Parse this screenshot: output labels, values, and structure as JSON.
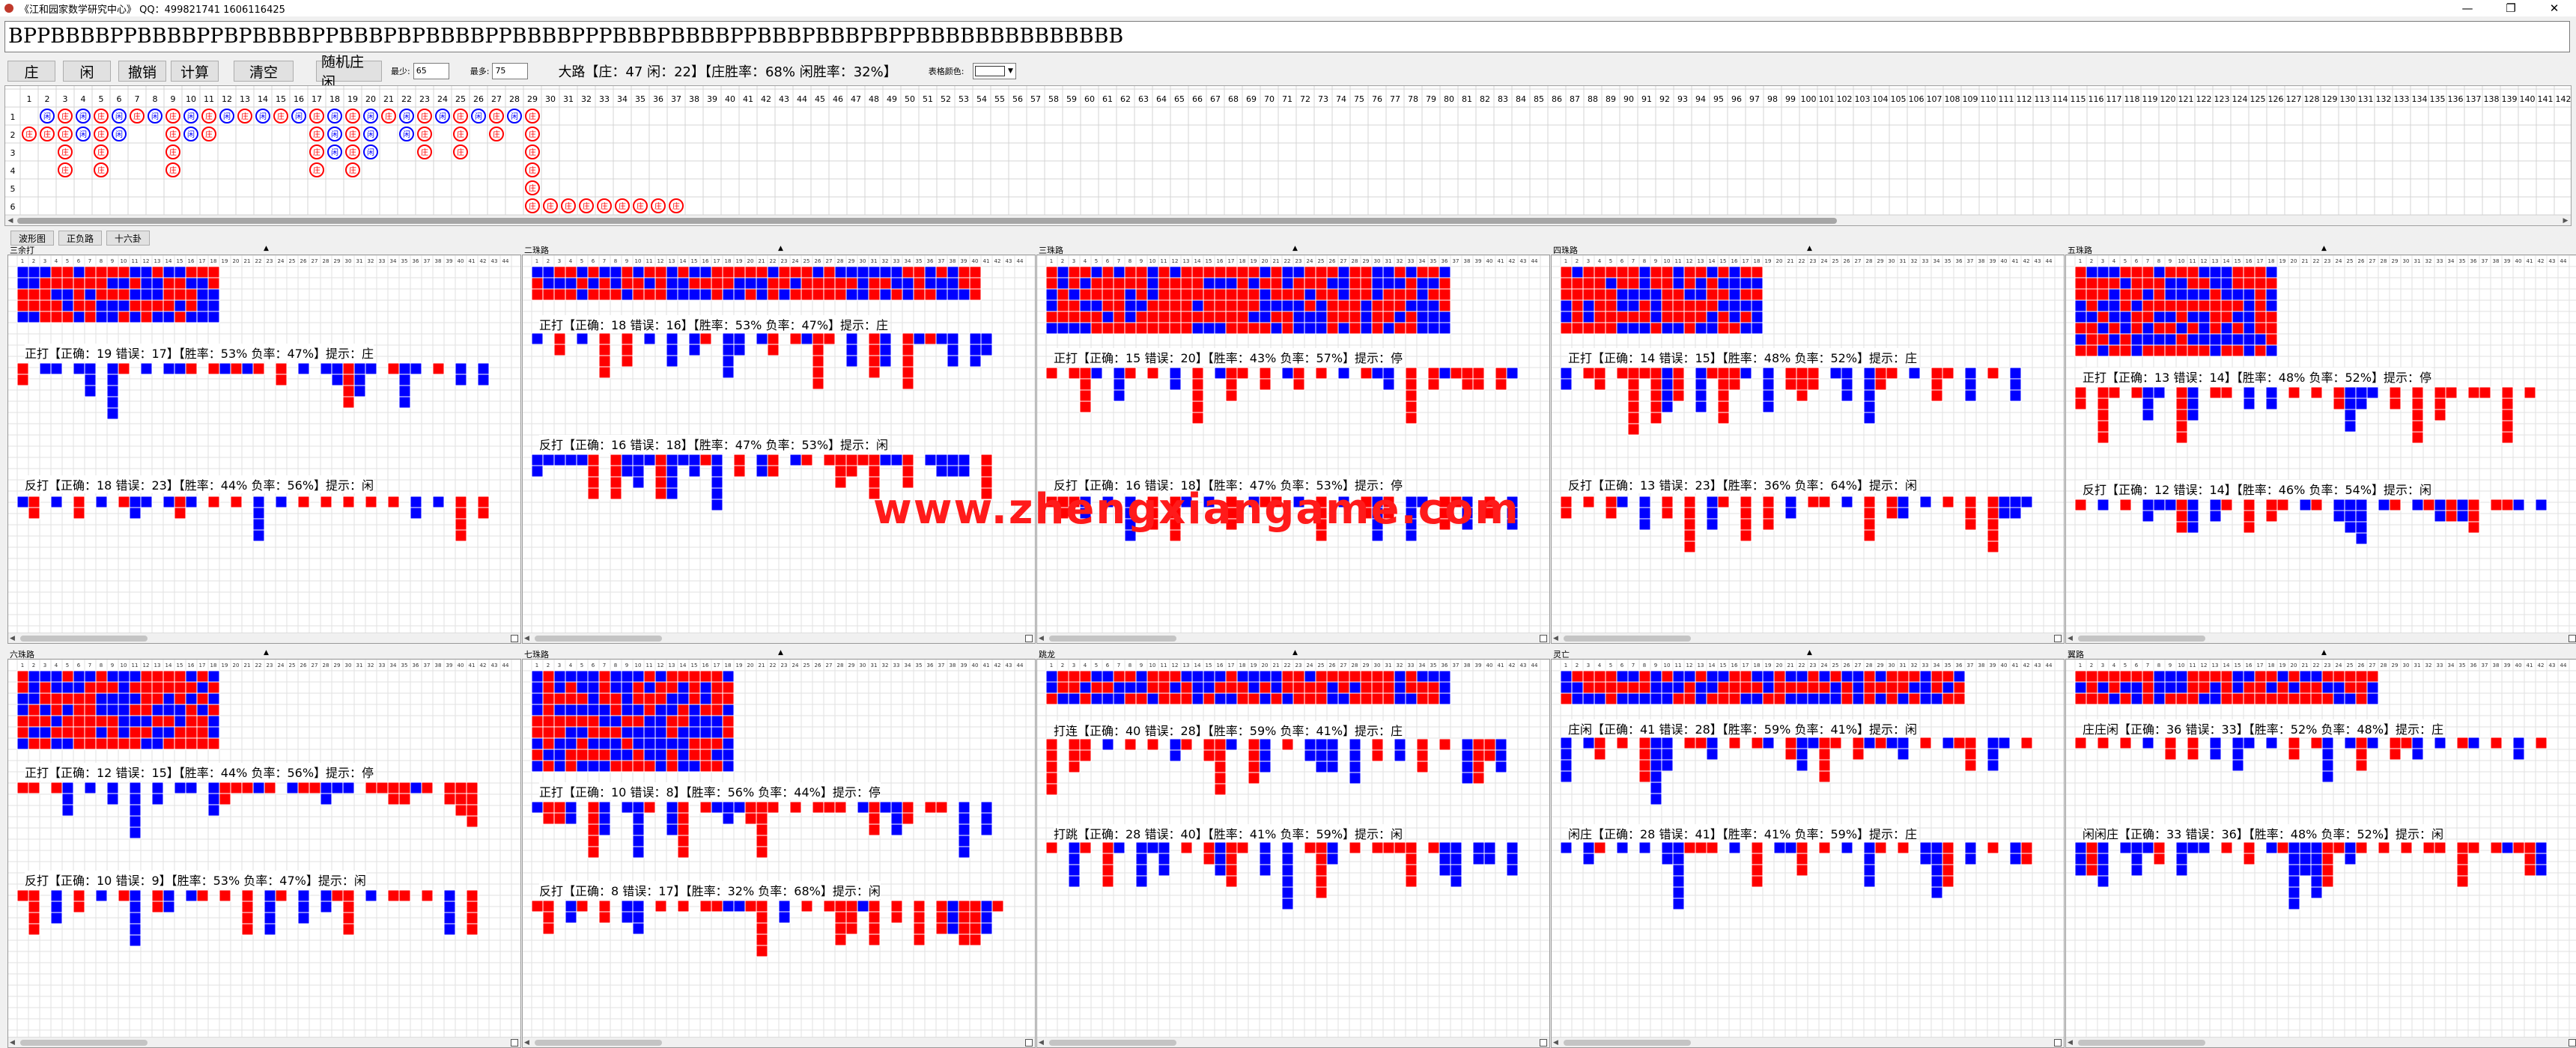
{
  "window": {
    "title": "《江和园家数学研究中心》 QQ：499821741 1606116425",
    "controls": [
      "—",
      "❐",
      "✕"
    ]
  },
  "sequence": "BPPBBBBPPBBBBPPBPBBBBPPBBBPBPBBBBPPBBBBPPPBBBPBBBBPPBBBPBBBPBPPBBBBBBBBBBBBBB",
  "toolbar": {
    "buttons": [
      "庄",
      "闲",
      "撤销",
      "计算",
      "清空",
      "随机庄闲"
    ],
    "min_label": "最少:",
    "min_value": "65",
    "max_label": "最多:",
    "max_value": "75",
    "stats_text": "大路【庄：47 闲：22】【庄胜率：68% 闲胜率：32%】",
    "color_label": "表格颜色:"
  },
  "big_road": {
    "column_count": 142,
    "row_labels": [
      "1",
      "2",
      "3",
      "4",
      "5",
      "6"
    ],
    "banker_char": "庄",
    "player_char": "闲",
    "cells": [
      [
        1,
        2,
        "B"
      ],
      [
        2,
        1,
        "P"
      ],
      [
        2,
        2,
        "B"
      ],
      [
        3,
        1,
        "B"
      ],
      [
        3,
        2,
        "B"
      ],
      [
        3,
        3,
        "B"
      ],
      [
        3,
        4,
        "B"
      ],
      [
        4,
        1,
        "P"
      ],
      [
        4,
        2,
        "P"
      ],
      [
        5,
        1,
        "B"
      ],
      [
        5,
        2,
        "B"
      ],
      [
        5,
        3,
        "B"
      ],
      [
        5,
        4,
        "B"
      ],
      [
        6,
        1,
        "P"
      ],
      [
        6,
        2,
        "P"
      ],
      [
        7,
        1,
        "B"
      ],
      [
        8,
        1,
        "P"
      ],
      [
        9,
        1,
        "B"
      ],
      [
        9,
        2,
        "B"
      ],
      [
        9,
        3,
        "B"
      ],
      [
        9,
        4,
        "B"
      ],
      [
        10,
        1,
        "P"
      ],
      [
        10,
        2,
        "P"
      ],
      [
        11,
        1,
        "B"
      ],
      [
        11,
        2,
        "B"
      ],
      [
        12,
        1,
        "P"
      ],
      [
        13,
        1,
        "B"
      ],
      [
        14,
        1,
        "P"
      ],
      [
        15,
        1,
        "B"
      ],
      [
        16,
        1,
        "P"
      ],
      [
        17,
        1,
        "B"
      ],
      [
        17,
        2,
        "B"
      ],
      [
        17,
        3,
        "B"
      ],
      [
        17,
        4,
        "B"
      ],
      [
        18,
        1,
        "P"
      ],
      [
        18,
        2,
        "P"
      ],
      [
        18,
        3,
        "P"
      ],
      [
        19,
        1,
        "B"
      ],
      [
        19,
        2,
        "B"
      ],
      [
        19,
        3,
        "B"
      ],
      [
        19,
        4,
        "B"
      ],
      [
        20,
        1,
        "P"
      ],
      [
        20,
        2,
        "P"
      ],
      [
        20,
        3,
        "P"
      ],
      [
        21,
        1,
        "B"
      ],
      [
        22,
        1,
        "P"
      ],
      [
        22,
        2,
        "P"
      ],
      [
        23,
        1,
        "B"
      ],
      [
        23,
        2,
        "B"
      ],
      [
        23,
        3,
        "B"
      ],
      [
        24,
        1,
        "P"
      ],
      [
        25,
        1,
        "B"
      ],
      [
        25,
        2,
        "B"
      ],
      [
        25,
        3,
        "B"
      ],
      [
        26,
        1,
        "P"
      ],
      [
        27,
        1,
        "B"
      ],
      [
        27,
        2,
        "B"
      ],
      [
        28,
        1,
        "P"
      ],
      [
        29,
        1,
        "B"
      ],
      [
        29,
        2,
        "B"
      ],
      [
        29,
        3,
        "B"
      ],
      [
        29,
        4,
        "B"
      ],
      [
        29,
        5,
        "B"
      ],
      [
        29,
        6,
        "B"
      ],
      [
        30,
        6,
        "B"
      ],
      [
        31,
        6,
        "B"
      ],
      [
        32,
        6,
        "B"
      ],
      [
        33,
        6,
        "B"
      ],
      [
        34,
        6,
        "B"
      ],
      [
        35,
        6,
        "B"
      ],
      [
        36,
        6,
        "B"
      ],
      [
        37,
        6,
        "B"
      ]
    ]
  },
  "tabs": [
    "波形图",
    "正负路",
    "十六卦"
  ],
  "colors": {
    "banker": "#ff0000",
    "player": "#0000ff",
    "grid": "#d4d4d4",
    "watermark": "#ff1a1a"
  },
  "panels": [
    {
      "title": "三余打",
      "rows": [
        {
          "label": "正打【正确：19 错误：17】【胜率：53% 负率：47%】提示：庄"
        },
        {
          "label": "反打【正确：18 错误：23】【胜率：44% 负率：56%】提示：闲"
        }
      ]
    },
    {
      "title": "二珠路",
      "rows": [
        {
          "label": "正打【正确：18 错误：16】【胜率：53% 负率：47%】提示：庄"
        },
        {
          "label": "反打【正确：16 错误：18】【胜率：47% 负率：53%】提示：闲"
        }
      ]
    },
    {
      "title": "三珠路",
      "rows": [
        {
          "label": "正打【正确：15 错误：20】【胜率：43% 负率：57%】提示：停"
        },
        {
          "label": "反打【正确：16 错误：18】【胜率：47% 负率：53%】提示：停"
        }
      ]
    },
    {
      "title": "四珠路",
      "rows": [
        {
          "label": "正打【正确：14 错误：15】【胜率：48% 负率：52%】提示：庄"
        },
        {
          "label": "反打【正确：13 错误：23】【胜率：36% 负率：64%】提示：闲"
        }
      ]
    },
    {
      "title": "五珠路",
      "rows": [
        {
          "label": "正打【正确：13 错误：14】【胜率：48% 负率：52%】提示：停"
        },
        {
          "label": "反打【正确：12 错误：14】【胜率：46% 负率：54%】提示：闲"
        }
      ]
    },
    {
      "title": "六珠路",
      "rows": [
        {
          "label": "正打【正确：12 错误：15】【胜率：44% 负率：56%】提示：停"
        },
        {
          "label": "反打【正确：10 错误：9】【胜率：53% 负率：47%】提示：闲"
        }
      ]
    },
    {
      "title": "七珠路",
      "rows": [
        {
          "label": "正打【正确：10 错误：8】【胜率：56% 负率：44%】提示：停"
        },
        {
          "label": "反打【正确：8 错误：17】【胜率：32% 负率：68%】提示：闲"
        }
      ]
    },
    {
      "title": "跳龙",
      "rows": [
        {
          "label": "打连【正确：40 错误：28】【胜率：59% 负率：41%】提示：庄"
        },
        {
          "label": "打跳【正确：28 错误：40】【胜率：41% 负率：59%】提示：闲"
        }
      ]
    },
    {
      "title": "灵亡",
      "rows": [
        {
          "label": "庄闲【正确：41 错误：28】【胜率：59% 负率：41%】提示：闲"
        },
        {
          "label": "闲庄【正确：28 错误：41】【胜率：41% 负率：59%】提示：庄"
        }
      ]
    },
    {
      "title": "翼路",
      "rows": [
        {
          "label": "庄庄闲【正确：36 错误：33】【胜率：52% 负率：48%】提示：庄"
        },
        {
          "label": "闲闲庄【正确：33 错误：36】【胜率：48% 负率：52%】提示：闲"
        }
      ]
    }
  ],
  "watermark": "www.zhengxiangame.com"
}
